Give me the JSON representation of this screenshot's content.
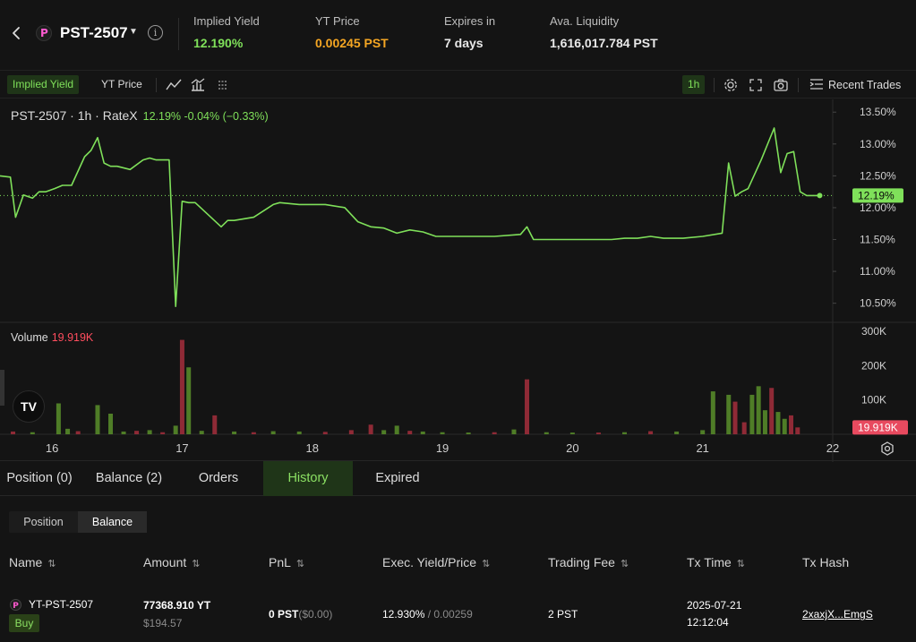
{
  "header": {
    "token": "PST-2507",
    "stats": [
      {
        "label": "Implied Yield",
        "value": "12.190%",
        "color": "#7fe05a"
      },
      {
        "label": "YT Price",
        "value": "0.00245 PST",
        "color": "#f5a623"
      },
      {
        "label": "Expires in",
        "value": "7 days",
        "color": "#ffffff"
      },
      {
        "label": "Ava. Liquidity",
        "value": "1,616,017.784 PST",
        "color": "#ffffff"
      }
    ]
  },
  "toolbar": {
    "tab_yield": "Implied Yield",
    "tab_price": "YT Price",
    "interval": "1h",
    "recent_trades": "Recent Trades"
  },
  "chart": {
    "legend_title": "PST-2507 · 1h · RateX",
    "legend_value": "12.19%  -0.04% (−0.33%)",
    "volume_label": "Volume",
    "volume_value": "19.919K",
    "last_value_badge": "12.19%",
    "volume_badge": "19.919K"
  },
  "chart_data": {
    "type": "line",
    "title": "PST-2507 · 1h · RateX",
    "y_ticks": [
      "13.50%",
      "13.00%",
      "12.50%",
      "12.00%",
      "11.50%",
      "11.00%",
      "10.50%"
    ],
    "y_range": [
      10.2,
      13.7
    ],
    "x_ticks": [
      "16",
      "17",
      "18",
      "19",
      "20",
      "21",
      "22"
    ],
    "x_range": [
      15.6,
      22.0
    ],
    "last_value": 12.19,
    "series": [
      {
        "name": "Implied Yield",
        "color": "#7fe05a",
        "x": [
          15.6,
          15.68,
          15.72,
          15.78,
          15.85,
          15.9,
          15.95,
          16.02,
          16.08,
          16.15,
          16.25,
          16.3,
          16.35,
          16.4,
          16.45,
          16.5,
          16.6,
          16.7,
          16.75,
          16.8,
          16.9,
          16.95,
          17.0,
          17.05,
          17.1,
          17.3,
          17.35,
          17.4,
          17.55,
          17.7,
          17.75,
          17.9,
          18.1,
          18.25,
          18.35,
          18.45,
          18.55,
          18.65,
          18.75,
          18.85,
          18.95,
          19.05,
          19.2,
          19.4,
          19.6,
          19.65,
          19.7,
          19.8,
          20.0,
          20.3,
          20.4,
          20.5,
          20.6,
          20.7,
          20.85,
          21.0,
          21.15,
          21.2,
          21.25,
          21.3,
          21.35,
          21.45,
          21.55,
          21.6,
          21.65,
          21.7,
          21.75,
          21.8,
          21.85,
          21.9
        ],
        "values": [
          12.5,
          12.48,
          11.85,
          12.2,
          12.15,
          12.25,
          12.25,
          12.3,
          12.35,
          12.35,
          12.8,
          12.9,
          13.1,
          12.7,
          12.65,
          12.65,
          12.6,
          12.75,
          12.78,
          12.75,
          12.75,
          10.45,
          12.1,
          12.08,
          12.08,
          11.7,
          11.8,
          11.8,
          11.85,
          12.05,
          12.08,
          12.05,
          12.05,
          12.0,
          11.78,
          11.7,
          11.68,
          11.6,
          11.65,
          11.62,
          11.55,
          11.55,
          11.55,
          11.55,
          11.58,
          11.7,
          11.5,
          11.5,
          11.5,
          11.5,
          11.52,
          11.52,
          11.55,
          11.52,
          11.52,
          11.55,
          11.6,
          12.7,
          12.18,
          12.25,
          12.3,
          12.75,
          13.25,
          12.55,
          12.85,
          12.88,
          12.25,
          12.19,
          12.19,
          12.19
        ]
      }
    ],
    "volume": {
      "ticks": [
        "300K",
        "200K",
        "100K"
      ],
      "y_range": [
        0,
        300000
      ],
      "bars": [
        {
          "x": 15.7,
          "v": 8000,
          "up": false
        },
        {
          "x": 15.85,
          "v": 6000,
          "up": true
        },
        {
          "x": 16.05,
          "v": 90000,
          "up": true
        },
        {
          "x": 16.12,
          "v": 16000,
          "up": true
        },
        {
          "x": 16.2,
          "v": 9000,
          "up": false
        },
        {
          "x": 16.35,
          "v": 85000,
          "up": true
        },
        {
          "x": 16.45,
          "v": 60000,
          "up": true
        },
        {
          "x": 16.55,
          "v": 8000,
          "up": true
        },
        {
          "x": 16.65,
          "v": 10000,
          "up": false
        },
        {
          "x": 16.75,
          "v": 12000,
          "up": true
        },
        {
          "x": 16.85,
          "v": 6000,
          "up": false
        },
        {
          "x": 16.95,
          "v": 25000,
          "up": true
        },
        {
          "x": 17.0,
          "v": 275000,
          "up": false
        },
        {
          "x": 17.05,
          "v": 195000,
          "up": true
        },
        {
          "x": 17.15,
          "v": 10000,
          "up": true
        },
        {
          "x": 17.25,
          "v": 55000,
          "up": false
        },
        {
          "x": 17.4,
          "v": 8000,
          "up": true
        },
        {
          "x": 17.55,
          "v": 6000,
          "up": false
        },
        {
          "x": 17.7,
          "v": 9000,
          "up": true
        },
        {
          "x": 17.9,
          "v": 8000,
          "up": true
        },
        {
          "x": 18.1,
          "v": 7000,
          "up": false
        },
        {
          "x": 18.3,
          "v": 12000,
          "up": false
        },
        {
          "x": 18.45,
          "v": 28000,
          "up": false
        },
        {
          "x": 18.55,
          "v": 12000,
          "up": true
        },
        {
          "x": 18.65,
          "v": 25000,
          "up": true
        },
        {
          "x": 18.75,
          "v": 10000,
          "up": false
        },
        {
          "x": 18.85,
          "v": 8000,
          "up": true
        },
        {
          "x": 19.0,
          "v": 6000,
          "up": true
        },
        {
          "x": 19.2,
          "v": 5000,
          "up": true
        },
        {
          "x": 19.4,
          "v": 6000,
          "up": false
        },
        {
          "x": 19.55,
          "v": 14000,
          "up": true
        },
        {
          "x": 19.65,
          "v": 160000,
          "up": false
        },
        {
          "x": 19.8,
          "v": 6000,
          "up": true
        },
        {
          "x": 20.0,
          "v": 5000,
          "up": true
        },
        {
          "x": 20.2,
          "v": 5000,
          "up": false
        },
        {
          "x": 20.4,
          "v": 6000,
          "up": true
        },
        {
          "x": 20.6,
          "v": 9000,
          "up": false
        },
        {
          "x": 20.8,
          "v": 8000,
          "up": true
        },
        {
          "x": 21.0,
          "v": 12000,
          "up": true
        },
        {
          "x": 21.08,
          "v": 125000,
          "up": true
        },
        {
          "x": 21.2,
          "v": 115000,
          "up": true
        },
        {
          "x": 21.25,
          "v": 95000,
          "up": false
        },
        {
          "x": 21.32,
          "v": 35000,
          "up": false
        },
        {
          "x": 21.38,
          "v": 115000,
          "up": true
        },
        {
          "x": 21.43,
          "v": 140000,
          "up": true
        },
        {
          "x": 21.48,
          "v": 70000,
          "up": true
        },
        {
          "x": 21.53,
          "v": 135000,
          "up": false
        },
        {
          "x": 21.58,
          "v": 65000,
          "up": true
        },
        {
          "x": 21.63,
          "v": 45000,
          "up": true
        },
        {
          "x": 21.68,
          "v": 55000,
          "up": false
        },
        {
          "x": 21.73,
          "v": 20000,
          "up": false
        }
      ]
    }
  },
  "bottom_tabs": [
    "Position (0)",
    "Balance (2)",
    "Orders",
    "History",
    "Expired"
  ],
  "sub_tabs": [
    "Position",
    "Balance"
  ],
  "table": {
    "headers": [
      "Name",
      "Amount",
      "PnL",
      "Exec. Yield/Price",
      "Trading Fee",
      "Tx Time",
      "Tx Hash"
    ],
    "rows": [
      {
        "name": "YT-PST-2507",
        "side": "Buy",
        "amount": "77368.910 YT",
        "amount_usd": "$194.57",
        "pnl": "0 PST",
        "pnl_usd": "($0.00)",
        "exec_yield": "12.930%",
        "exec_price": " / 0.00259",
        "fee": "2 PST",
        "tx_date": "2025-07-21",
        "tx_time": "12:12:04",
        "tx_hash": "2xaxjX...EmgS"
      }
    ]
  }
}
